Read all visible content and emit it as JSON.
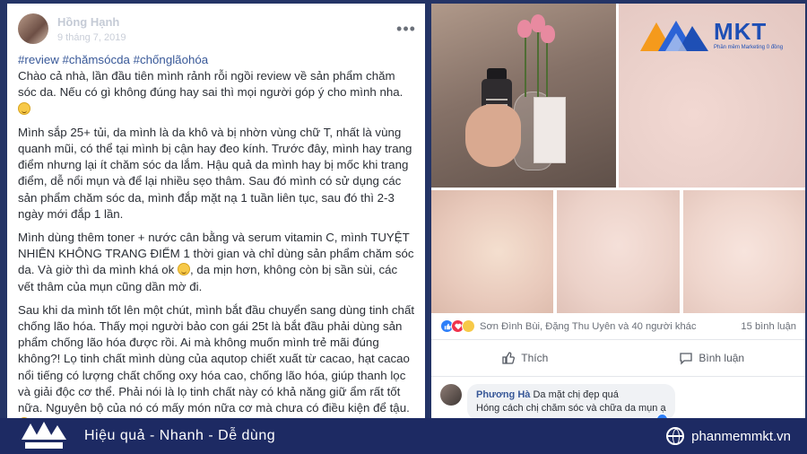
{
  "post": {
    "author": "Hồng Hạnh",
    "date": "9 tháng 7, 2019",
    "hashtags": "#review #chămsócda #chốnglãohóa",
    "paragraphs": [
      "Chào cả nhà, lần đầu tiên mình rảnh rỗi ngồi review về sản phẩm chăm sóc da. Nếu có gì không đúng hay sai thì mọi người góp ý cho mình nha.",
      "Mình sắp 25+ tủi, da mình là da khô và bị nhờn vùng chữ T, nhất là vùng quanh mũi, có thể tại mình bị cận hay đeo kính. Trước đây, mình hay trang điểm nhưng lại ít chăm sóc da lắm. Hậu quả da mình hay bị mốc khi trang điểm, dễ nổi mụn và để lại nhiều sẹo thâm. Sau đó mình có sử dụng các sản phẩm chăm sóc da, mình đắp mặt nạ 1 tuần liên tục, sau đó thì 2-3 ngày mới đắp 1 lần.",
      "Mình dùng thêm toner + nước cân bằng và serum vitamin C, mình TUYỆT NHIÊN KHÔNG TRANG ĐIỂM 1 thời gian và chỉ dùng sản phẩm chăm sóc da. Và giờ thì da mình khá ok",
      ", da mịn hơn, không còn bị sần sùi, các vết thâm của mụn cũng dần mờ đi.",
      "Sau khi da mình tốt lên một chút, mình bắt đầu chuyển sang dùng tinh chất chống lão hóa. Thấy mọi người bảo con gái 25t là bắt đầu phải dùng sản phẩm chống lão hóa được rồi. Ai mà không muốn mình trẻ mãi đúng không?! Lọ tinh chất mình dùng của aqutop chiết xuất từ cacao, hạt cacao nổi tiếng có lượng chất chống oxy hóa cao, chống lão hóa, giúp thanh lọc và giải độc cơ thể. Phải nói là lọ tinh chất này có khả năng giữ ẩm rất tốt nữa. Nguyên bộ của nó có mấy món nữa cơ mà chưa có điều kiện để tậu."
    ]
  },
  "reactions": {
    "names": "Sơn Đình Bùi, Đặng Thu Uyên và 40 người khác",
    "comment_count": "15 bình luận",
    "like_label": "Thích",
    "comment_label": "Bình luận"
  },
  "comment": {
    "name": "Phương Hà",
    "text1": "Da mặt chị đẹp quá",
    "text2": "Hóng cách chị chăm sóc và chữa da mụn ạ"
  },
  "logo": {
    "name": "MKT",
    "tagline": "Phần mềm Marketing 0 đồng"
  },
  "banner": {
    "slogan": "Hiệu quả - Nhanh - Dễ dùng",
    "website": "phanmemmkt.vn"
  },
  "colors": {
    "link": "#385898",
    "banner_bg": "#1d2a63",
    "logo_blue": "#1e4fb5",
    "logo_orange": "#f59a1c"
  }
}
